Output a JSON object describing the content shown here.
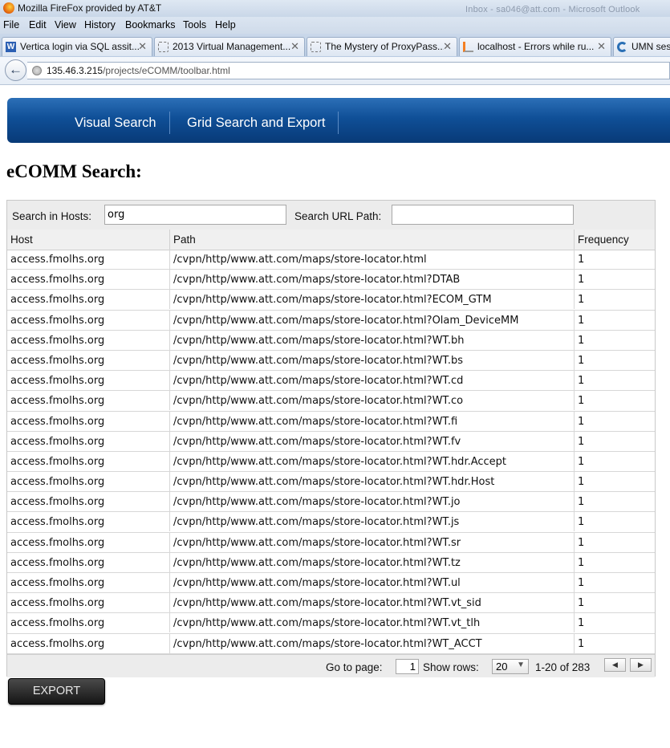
{
  "browser": {
    "window_title": "Mozilla FireFox provided by AT&T",
    "title_ghost": "Inbox - sa046@att.com - Microsoft Outlook",
    "menu": [
      "File",
      "Edit",
      "View",
      "History",
      "Bookmarks",
      "Tools",
      "Help"
    ],
    "tabs": [
      {
        "label": "Vertica login via SQL assit...",
        "icon": "w-icon"
      },
      {
        "label": "2013 Virtual Management...",
        "icon": "blank-page-icon"
      },
      {
        "label": "The Mystery of ProxyPass...",
        "icon": "blank-page-icon"
      },
      {
        "label": "localhost - Errors while ru...",
        "icon": "stackoverflow-icon"
      },
      {
        "label": "UMN ses",
        "icon": "c-icon"
      }
    ],
    "url_host": "135.46.3.215",
    "url_path": "/projects/eCOMM/toolbar.html"
  },
  "appnav": {
    "items": [
      "Visual Search",
      "Grid Search and Export"
    ],
    "color": "#0f4f97"
  },
  "page": {
    "title": "eCOMM Search:"
  },
  "search": {
    "hosts_label": "Search in Hosts:",
    "hosts_value": "org",
    "path_label": "Search URL Path:",
    "path_value": ""
  },
  "table": {
    "columns": [
      "Host",
      "Path",
      "Frequency"
    ],
    "rows": [
      [
        "access.fmolhs.org",
        "/cvpn/http/www.att.com/maps/store-locator.html",
        "1"
      ],
      [
        "access.fmolhs.org",
        "/cvpn/http/www.att.com/maps/store-locator.html?DTAB",
        "1"
      ],
      [
        "access.fmolhs.org",
        "/cvpn/http/www.att.com/maps/store-locator.html?ECOM_GTM",
        "1"
      ],
      [
        "access.fmolhs.org",
        "/cvpn/http/www.att.com/maps/store-locator.html?Olam_DeviceMM",
        "1"
      ],
      [
        "access.fmolhs.org",
        "/cvpn/http/www.att.com/maps/store-locator.html?WT.bh",
        "1"
      ],
      [
        "access.fmolhs.org",
        "/cvpn/http/www.att.com/maps/store-locator.html?WT.bs",
        "1"
      ],
      [
        "access.fmolhs.org",
        "/cvpn/http/www.att.com/maps/store-locator.html?WT.cd",
        "1"
      ],
      [
        "access.fmolhs.org",
        "/cvpn/http/www.att.com/maps/store-locator.html?WT.co",
        "1"
      ],
      [
        "access.fmolhs.org",
        "/cvpn/http/www.att.com/maps/store-locator.html?WT.fi",
        "1"
      ],
      [
        "access.fmolhs.org",
        "/cvpn/http/www.att.com/maps/store-locator.html?WT.fv",
        "1"
      ],
      [
        "access.fmolhs.org",
        "/cvpn/http/www.att.com/maps/store-locator.html?WT.hdr.Accept",
        "1"
      ],
      [
        "access.fmolhs.org",
        "/cvpn/http/www.att.com/maps/store-locator.html?WT.hdr.Host",
        "1"
      ],
      [
        "access.fmolhs.org",
        "/cvpn/http/www.att.com/maps/store-locator.html?WT.jo",
        "1"
      ],
      [
        "access.fmolhs.org",
        "/cvpn/http/www.att.com/maps/store-locator.html?WT.js",
        "1"
      ],
      [
        "access.fmolhs.org",
        "/cvpn/http/www.att.com/maps/store-locator.html?WT.sr",
        "1"
      ],
      [
        "access.fmolhs.org",
        "/cvpn/http/www.att.com/maps/store-locator.html?WT.tz",
        "1"
      ],
      [
        "access.fmolhs.org",
        "/cvpn/http/www.att.com/maps/store-locator.html?WT.ul",
        "1"
      ],
      [
        "access.fmolhs.org",
        "/cvpn/http/www.att.com/maps/store-locator.html?WT.vt_sid",
        "1"
      ],
      [
        "access.fmolhs.org",
        "/cvpn/http/www.att.com/maps/store-locator.html?WT.vt_tlh",
        "1"
      ],
      [
        "access.fmolhs.org",
        "/cvpn/http/www.att.com/maps/store-locator.html?WT_ACCT",
        "1"
      ]
    ]
  },
  "pager": {
    "goto_label": "Go to page:",
    "page_value": "1",
    "rows_label": "Show rows:",
    "rows_value": "20",
    "range_text": "1-20 of 283"
  },
  "export": {
    "label": "EXPORT"
  }
}
